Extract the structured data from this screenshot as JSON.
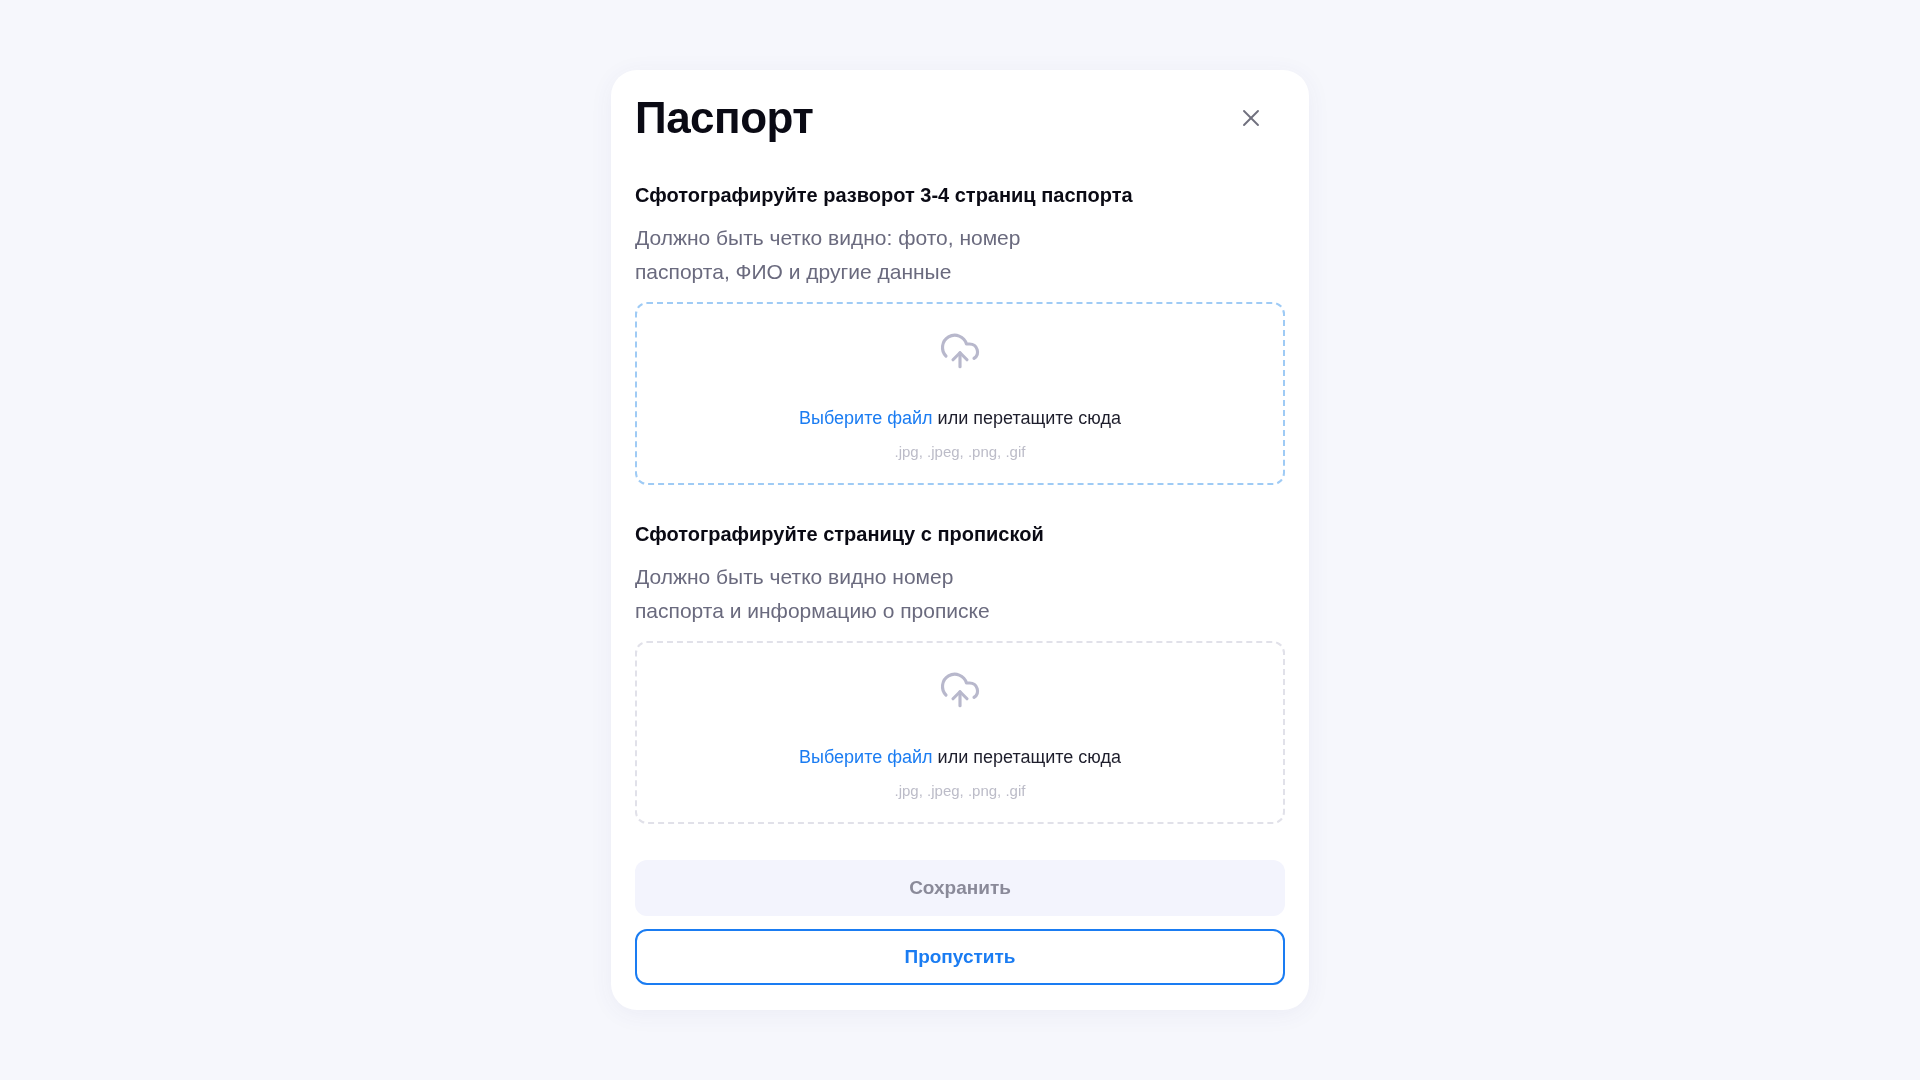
{
  "modal": {
    "title": "Паспорт"
  },
  "sections": [
    {
      "heading": "Сфотографируйте разворот 3-4 страниц паспорта",
      "description": "Должно быть четко видно: фото, номер паспорта, ФИО и другие данные",
      "upload": {
        "highlighted": true,
        "link": "Выберите файл",
        "prompt": "или перетащите сюда",
        "formats": ".jpg, .jpeg, .png, .gif"
      }
    },
    {
      "heading": "Сфотографируйте страницу с пропиской",
      "description": "Должно быть четко видно номер паспорта и информацию о прописке",
      "upload": {
        "highlighted": false,
        "link": "Выберите файл",
        "prompt": "или перетащите сюда",
        "formats": ".jpg, .jpeg, .png, .gif"
      }
    }
  ],
  "buttons": [
    {
      "label": "Сохранить",
      "kind": "primary",
      "disabled": true
    },
    {
      "label": "Пропустить",
      "kind": "outline",
      "disabled": false
    }
  ]
}
